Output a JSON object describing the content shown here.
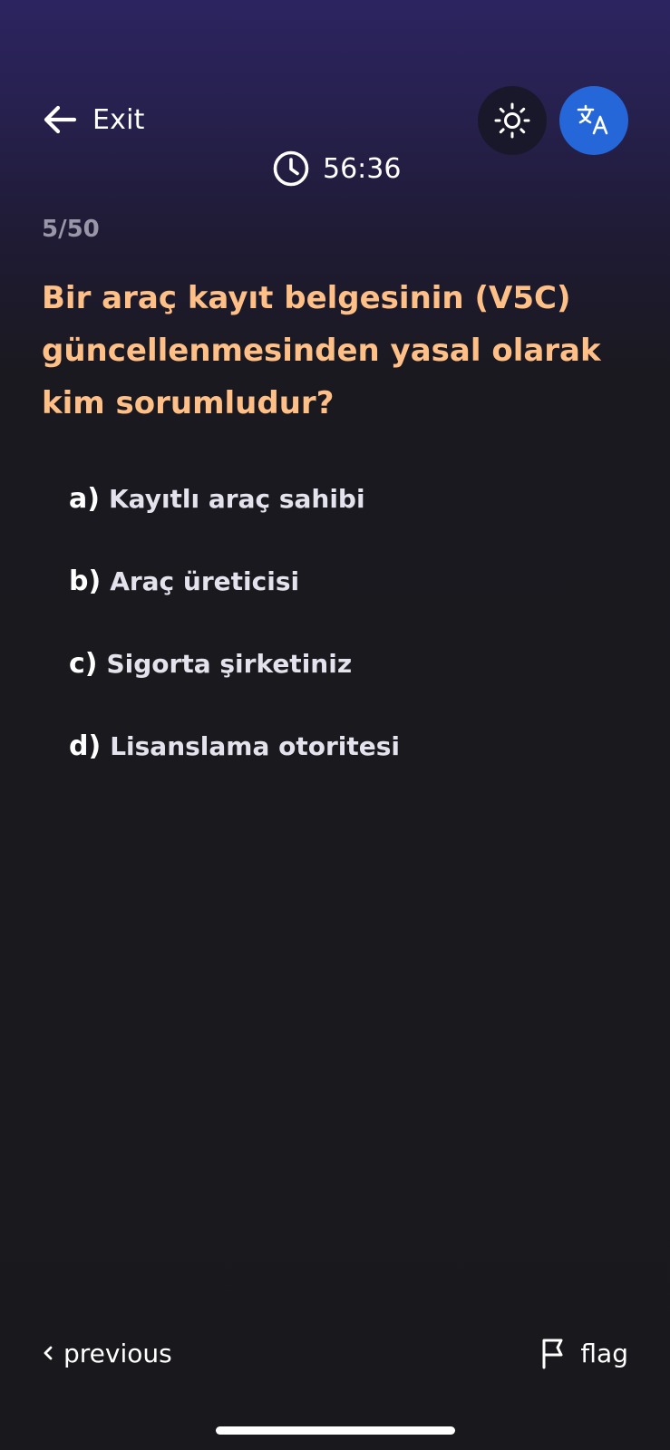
{
  "header": {
    "exit_label": "Exit",
    "exit_icon": "arrow-left-icon",
    "theme_icon": "sun-icon",
    "language_icon": "translate-icon",
    "language_button_color": "#2566d8"
  },
  "timer": {
    "icon": "clock-icon",
    "remaining": "56:36"
  },
  "quiz": {
    "progress": "5/50",
    "current": 5,
    "total": 50,
    "question": "Bir araç kayıt belgesinin (V5C) güncellenmesinden yasal olarak kim sorumludur?",
    "question_color": "#ffc088",
    "answers": [
      {
        "letter": "a)",
        "text": "Kayıtlı araç sahibi"
      },
      {
        "letter": "b)",
        "text": "Araç üreticisi"
      },
      {
        "letter": "c)",
        "text": "Sigorta şirketiniz"
      },
      {
        "letter": "d)",
        "text": "Lisanslama otoritesi"
      }
    ]
  },
  "footer": {
    "previous_label": "previous",
    "previous_icon": "chevron-left-icon",
    "flag_label": "flag",
    "flag_icon": "flag-icon"
  }
}
